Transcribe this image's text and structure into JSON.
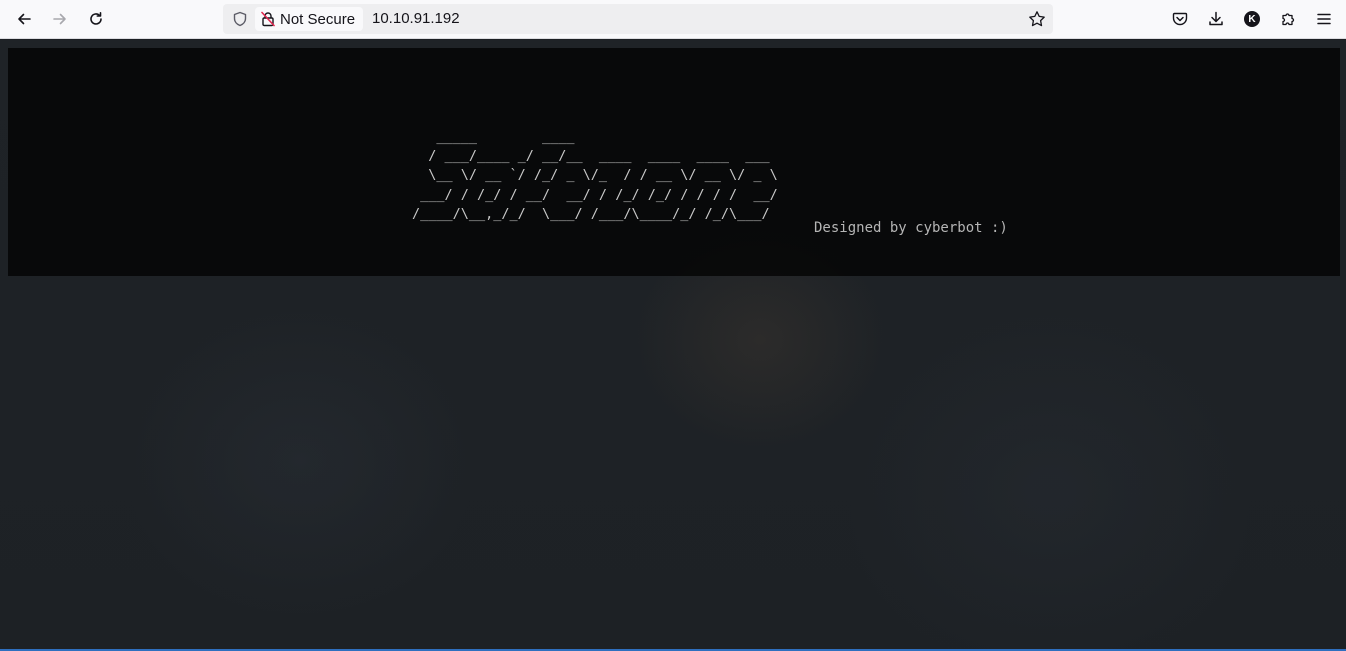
{
  "browser": {
    "security_label": "Not Secure",
    "url": "10.10.91.192",
    "account_initial": "K",
    "icons": {
      "back": "arrow-left-icon",
      "forward": "arrow-right-icon",
      "reload": "reload-icon",
      "tracking_protection": "shield-icon",
      "insecure": "broken-lock-icon",
      "bookmark": "star-icon",
      "pocket": "pocket-icon",
      "downloads": "download-icon",
      "extensions": "puzzle-icon",
      "menu": "hamburger-menu-icon"
    }
  },
  "page": {
    "ascii_art": "   _____        ____\n  / ___/____ _/ __/__  ____  ____  ____  ___\n  \\__ \\/ __ `/ /_/ _ \\/_  / / __ \\/ __ \\/ _ \\\n ___/ / /_/ / __/  __/ / /_/ /_/ / / / /  __/\n/____/\\__,_/_/  \\___/ /___/\\____/_/ /_/\\___/",
    "credit": "Designed by cyberbot :)"
  },
  "colors": {
    "banner_bg": "#000000",
    "page_bg": "#1f2327",
    "text": "#c9c9c9"
  }
}
